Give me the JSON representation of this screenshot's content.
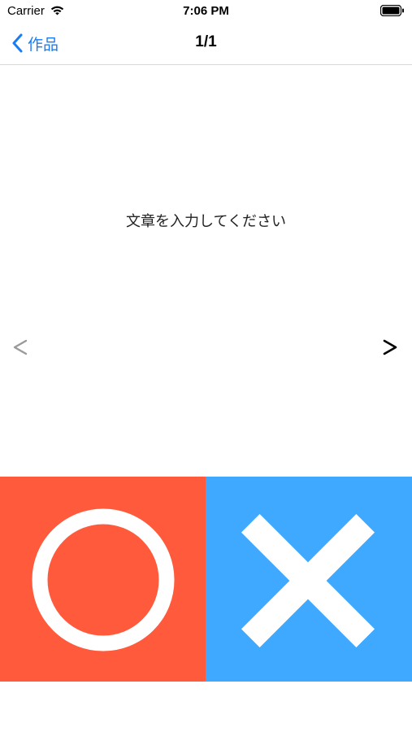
{
  "status_bar": {
    "carrier": "Carrier",
    "time": "7:06 PM",
    "wifi_icon": "wifi-icon",
    "battery_icon": "battery-icon"
  },
  "nav": {
    "back_label": "作品",
    "back_icon": "chevron-left-icon",
    "title": "1/1",
    "accent_color": "#1a7cf5"
  },
  "content": {
    "message": "文章を入力してください",
    "prev_icon": "chevron-left-icon",
    "next_icon": "chevron-right-icon",
    "prev_enabled": false,
    "next_enabled": true
  },
  "answers": {
    "correct": {
      "icon": "circle-icon",
      "color": "#ff5a3c"
    },
    "wrong": {
      "icon": "cross-icon",
      "color": "#3fa9ff"
    }
  }
}
